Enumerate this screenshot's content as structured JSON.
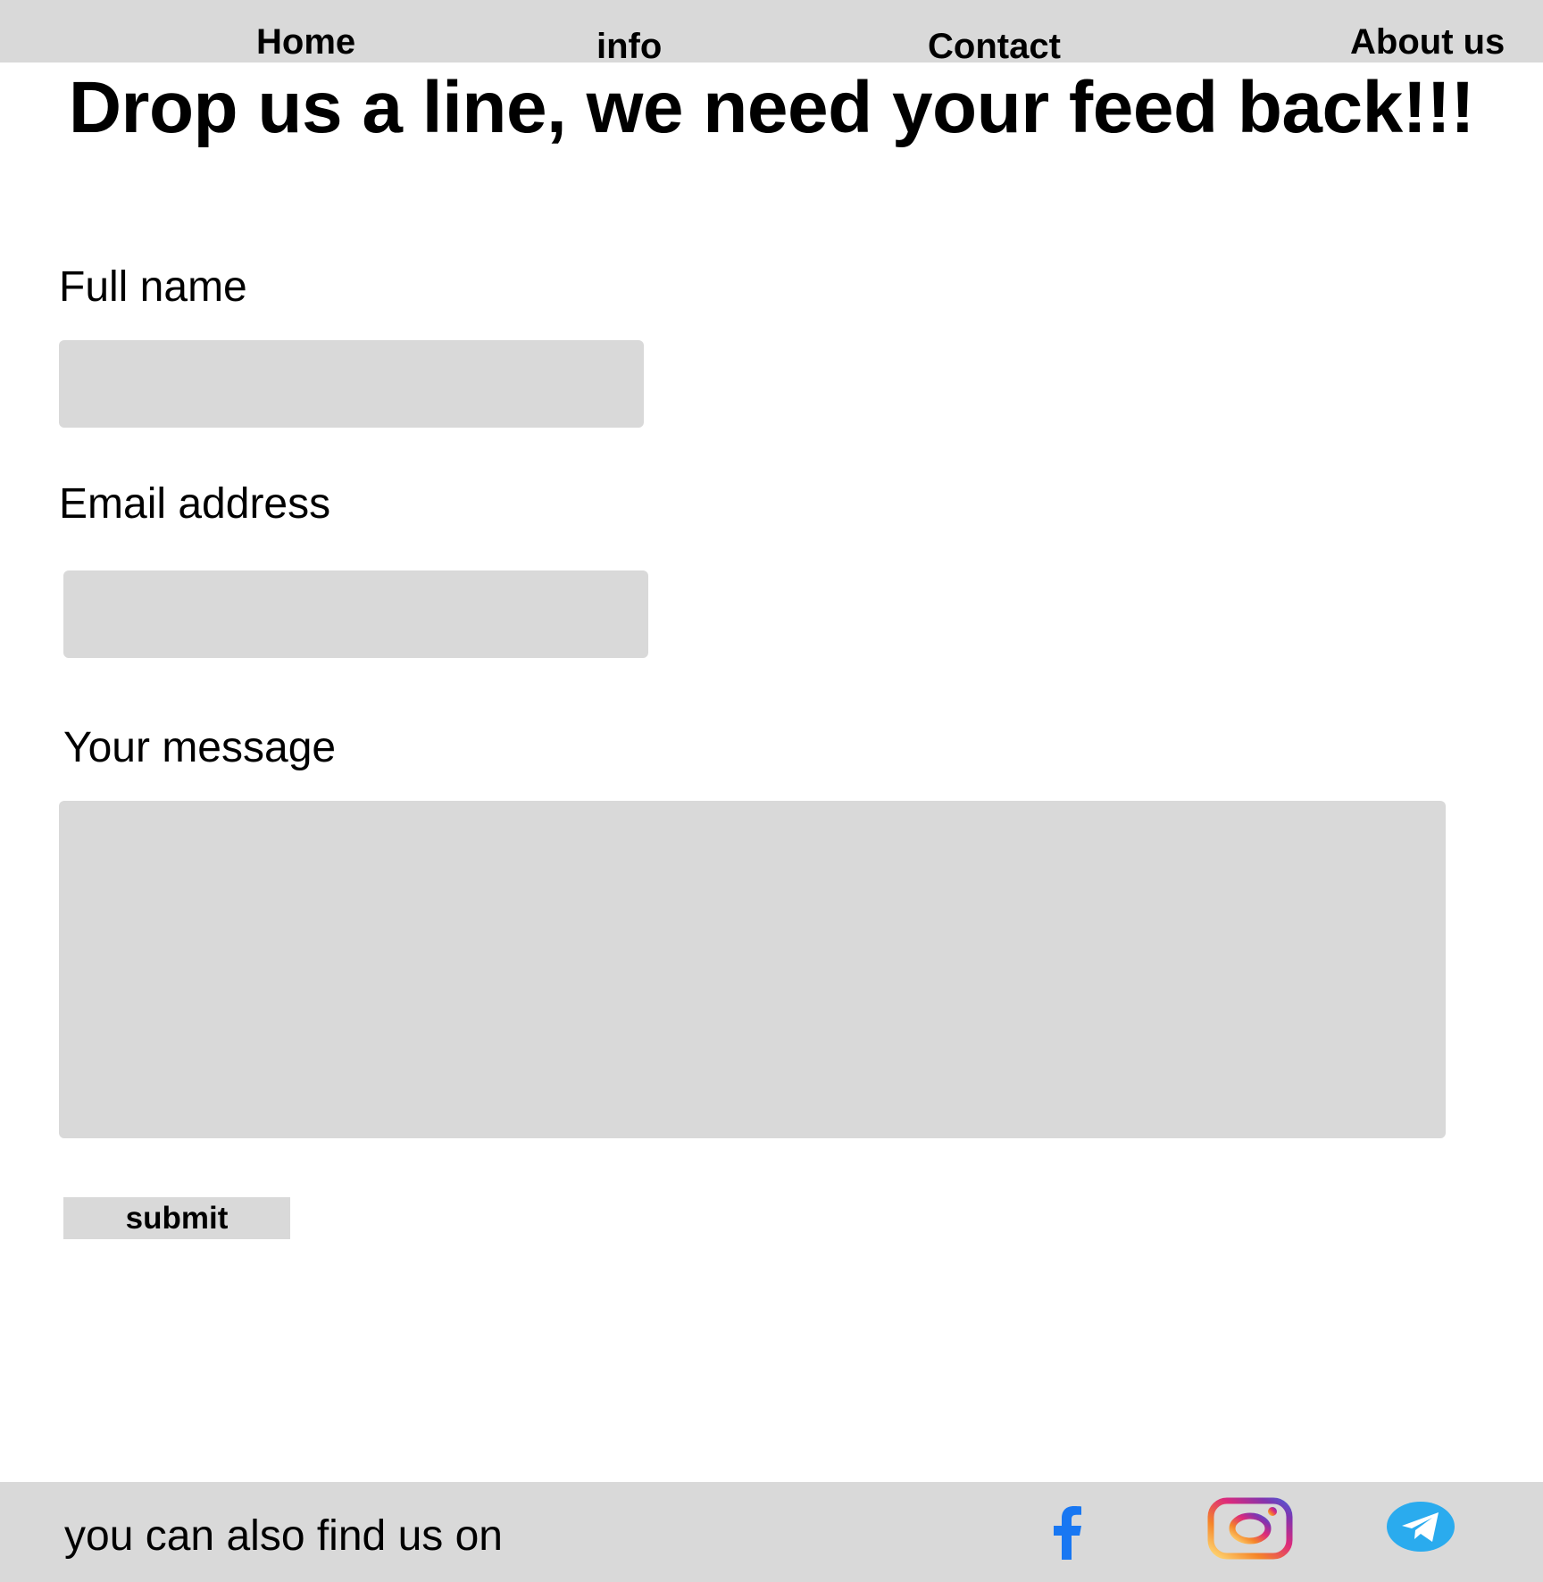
{
  "nav": {
    "items": [
      {
        "label": "Home"
      },
      {
        "label": "info"
      },
      {
        "label": "Contact"
      },
      {
        "label": "About us"
      }
    ]
  },
  "page": {
    "headline": "Drop us a line, we need your feed back!!!"
  },
  "form": {
    "full_name": {
      "label": "Full name",
      "value": "",
      "placeholder": ""
    },
    "email": {
      "label": "Email address",
      "value": "",
      "placeholder": ""
    },
    "message": {
      "label": "Your message",
      "value": "",
      "placeholder": ""
    },
    "submit_label": "submit"
  },
  "footer": {
    "text": "you can also find us on",
    "social": [
      {
        "icon": "facebook-icon",
        "color": "#1877f2"
      },
      {
        "icon": "instagram-icon",
        "colors": [
          "#515bd4",
          "#8134af",
          "#dd2a7b",
          "#f58529",
          "#feda77"
        ]
      },
      {
        "icon": "telegram-icon",
        "color": "#2aabee"
      }
    ]
  },
  "colors": {
    "bar_background": "#d9d9d9",
    "field_background": "#d9d9d9",
    "page_background": "#ffffff",
    "text": "#000000"
  }
}
